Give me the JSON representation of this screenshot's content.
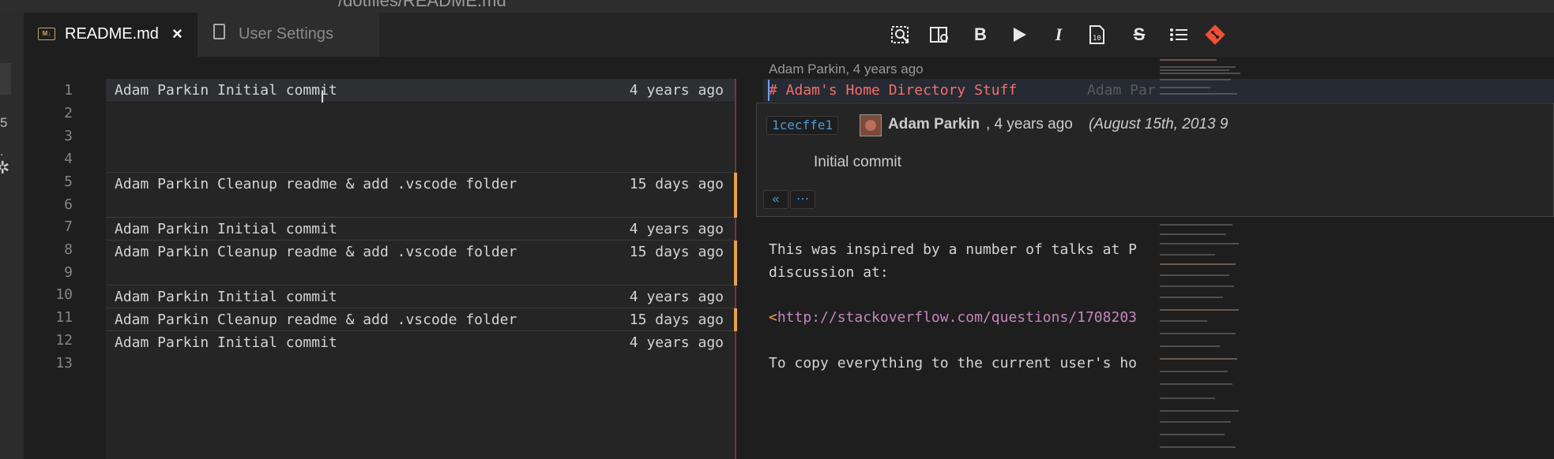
{
  "window": {
    "title": "/dotfiles/README.md"
  },
  "activity_bar": {
    "badge_count": "5",
    "dot": "."
  },
  "tabs": [
    {
      "label": "README.md",
      "icon": "M↓"
    },
    {
      "label": "User Settings"
    }
  ],
  "toolbar": {
    "icons": [
      "preview-search-icon",
      "open-preview-side-icon",
      "bold-icon",
      "run-icon",
      "italic-icon",
      "code-block-icon",
      "strikethrough-icon",
      "bullet-list-icon",
      "git-icon"
    ],
    "bold": "B",
    "italic": "I",
    "strike": "S"
  },
  "line_numbers": [
    "1",
    "2",
    "3",
    "4",
    "5",
    "6",
    "7",
    "8",
    "9",
    "10",
    "11",
    "12",
    "13"
  ],
  "blame": [
    {
      "text": "Adam Parkin Initial commit",
      "ago": "4 years ago"
    },
    {
      "text": "Adam Parkin Cleanup readme & add .vscode folder",
      "ago": "15 days ago"
    },
    {
      "text": "Adam Parkin Initial commit",
      "ago": "4 years ago"
    },
    {
      "text": "Adam Parkin Cleanup readme & add .vscode folder",
      "ago": "15 days ago"
    },
    {
      "text": "Adam Parkin Initial commit",
      "ago": "4 years ago"
    },
    {
      "text": "Adam Parkin Cleanup readme & add .vscode folder",
      "ago": "15 days ago"
    },
    {
      "text": "Adam Parkin Initial commit",
      "ago": "4 years ago"
    }
  ],
  "editor": {
    "codelens": "Adam Parkin, 4 years ago",
    "heading": "# Adam's Home Directory Stuff",
    "heading_blame": "Adam Par",
    "line8": "This was inspired by a number of talks at P",
    "line9": "discussion at:",
    "line11_open": "<",
    "line11_url": "http://stackoverflow.com/questions/1708203",
    "line13": "To copy everything to the current user's ho"
  },
  "hover": {
    "sha": "1cecffe1",
    "author": "Adam Parkin",
    "when": ", 4 years ago",
    "date": "(August 15th, 2013 9",
    "message": "Initial commit",
    "button_back": "«",
    "button_more": "⋯"
  },
  "colors": {
    "recent_marker": "#e8a24a",
    "heading": "#f47067",
    "url": "#c586c0",
    "sha": "#4a9bd6"
  }
}
